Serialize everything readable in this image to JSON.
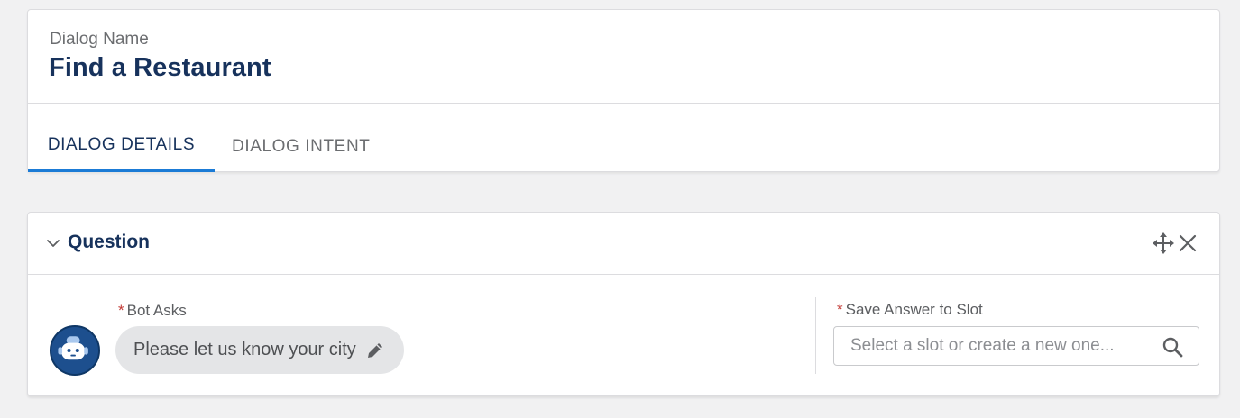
{
  "header": {
    "name_label": "Dialog Name",
    "name_value": "Find a Restaurant"
  },
  "tabs": [
    {
      "label": "DIALOG DETAILS",
      "active": true
    },
    {
      "label": "DIALOG INTENT",
      "active": false
    }
  ],
  "question": {
    "title": "Question",
    "bot_asks_label": "Bot Asks",
    "bot_asks_value": "Please let us know your city",
    "save_slot_label": "Save Answer to Slot",
    "save_slot_placeholder": "Select a slot or create a new one...",
    "required_marker": "*"
  },
  "icons": {
    "collapse": "chevron-down-icon",
    "move": "move-icon",
    "close": "close-icon",
    "edit": "pencil-icon",
    "search": "search-icon",
    "bot": "bot-avatar-icon"
  },
  "colors": {
    "title": "#17325c",
    "active_tab_underline": "#1b7bd6",
    "required": "#c23934",
    "avatar_bg": "#1d4f8e"
  }
}
